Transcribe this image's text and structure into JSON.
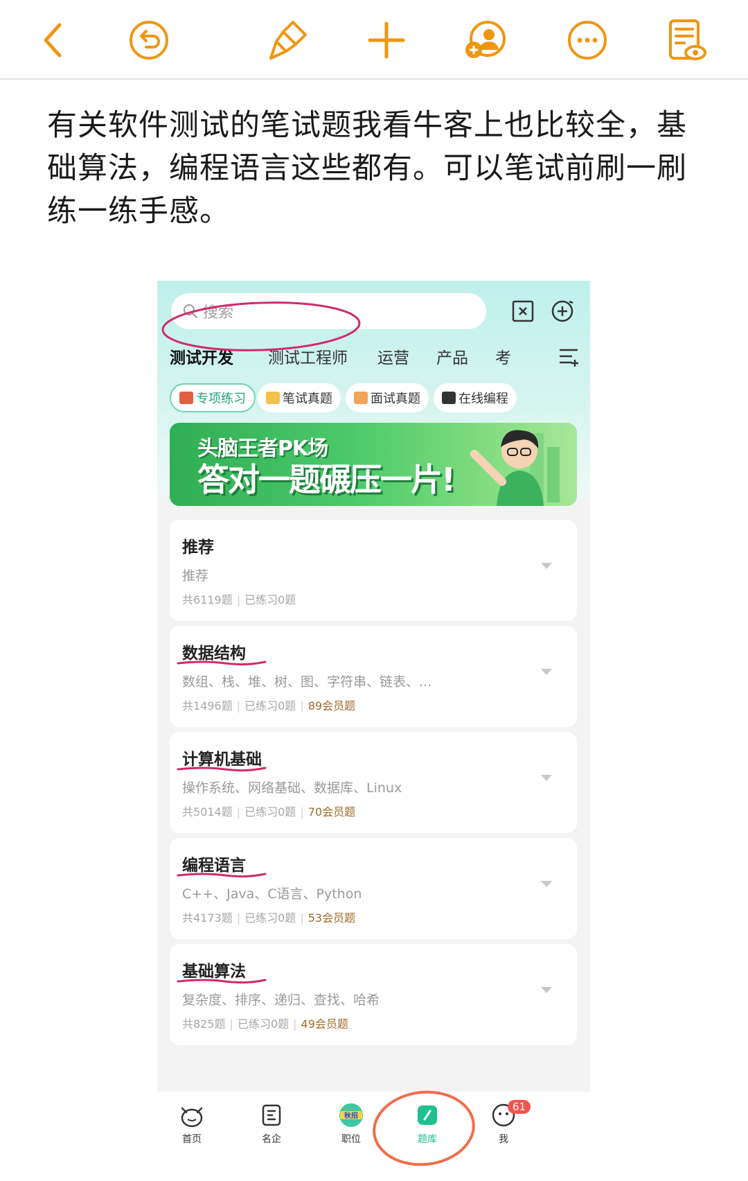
{
  "toolbar": {
    "accent": "#f0960f",
    "items": [
      "back-icon",
      "undo-icon",
      "brush-icon",
      "add-icon",
      "add-collaborator-icon",
      "more-icon",
      "document-view-icon"
    ]
  },
  "article": {
    "text": "有关软件测试的笔试题我看牛客上也比较全，基础算法，编程语言这些都有。可以笔试前刷一刷练一练手感。"
  },
  "app": {
    "search": {
      "placeholder": "搜索"
    },
    "tabs": [
      "测试开发",
      "测试工程师",
      "运营",
      "产品",
      "考"
    ],
    "chips": [
      "专项练习",
      "笔试真题",
      "面试真题",
      "在线编程"
    ],
    "banner": {
      "line1": "头脑王者PK场",
      "line2": "答对一题碾压一片!"
    },
    "cards": [
      {
        "title": "推荐",
        "desc": "推荐",
        "total": "共6119题",
        "done": "已练习0题",
        "vip": ""
      },
      {
        "title": "数据结构",
        "desc": "数组、栈、堆、树、图、字符串、链表、...",
        "total": "共1496题",
        "done": "已练习0题",
        "vip": "89会员题"
      },
      {
        "title": "计算机基础",
        "desc": "操作系统、网络基础、数据库、Linux",
        "total": "共5014题",
        "done": "已练习0题",
        "vip": "70会员题"
      },
      {
        "title": "编程语言",
        "desc": "C++、Java、C语言、Python",
        "total": "共4173题",
        "done": "已练习0题",
        "vip": "53会员题"
      },
      {
        "title": "基础算法",
        "desc": "复杂度、排序、递归、查找、哈希",
        "total": "共825题",
        "done": "已练习0题",
        "vip": "49会员题"
      }
    ],
    "nav": {
      "items": [
        "首页",
        "名企",
        "职位",
        "题库",
        "我"
      ],
      "autumn_badge": "秋招",
      "badge_count": "61"
    },
    "colors": {
      "primary": "#1fbf8f",
      "annotation": "#d12a6a",
      "circle": "#f06d4a"
    }
  }
}
